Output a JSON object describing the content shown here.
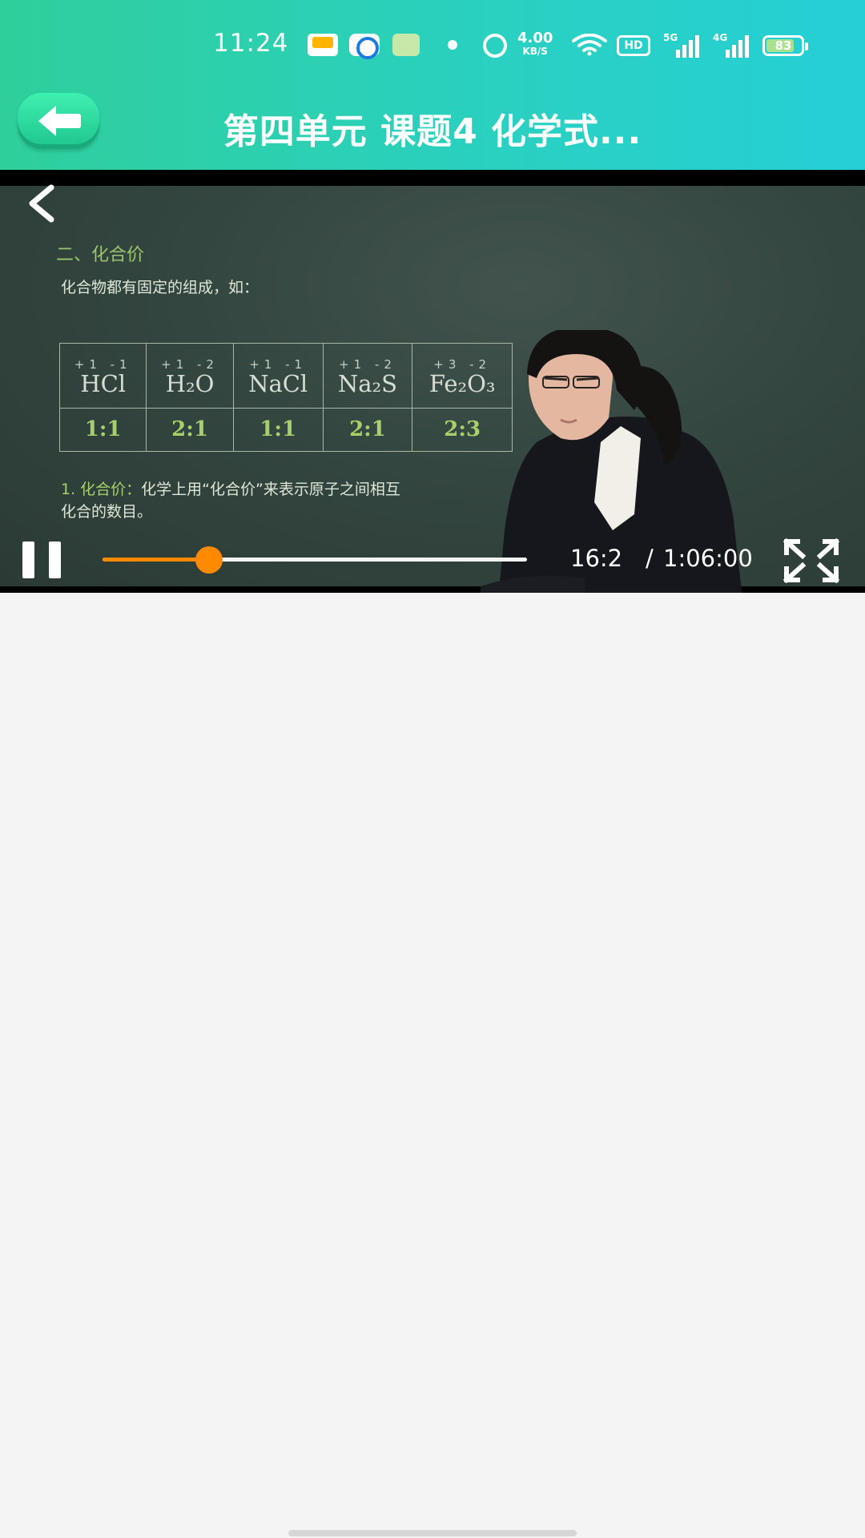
{
  "status_bar": {
    "time": "11:24",
    "net_speed_value": "4.00",
    "net_speed_unit": "KB/S",
    "hd_label": "HD",
    "signal_1_label": "5G",
    "signal_2_label": "4G",
    "battery_percent": "83",
    "battery_level": 0.83,
    "icons": [
      "app-icon-1",
      "app-icon-2",
      "app-icon-3",
      "dot-icon",
      "alarm-icon",
      "wifi-icon",
      "hd-icon",
      "signal-5g-icon",
      "signal-4g-icon",
      "battery-icon"
    ]
  },
  "title_bar": {
    "back_icon": "arrow-left-icon",
    "title": "第四单元 课题4 化学式..."
  },
  "video": {
    "board": {
      "heading": "二、化合价",
      "intro": "化合物都有固定的组成，如：",
      "table": [
        {
          "valence": "+1 -1",
          "formula": "HCl",
          "ratio": "1:1"
        },
        {
          "valence": "+1 -2",
          "formula": "H₂O",
          "ratio": "2:1"
        },
        {
          "valence": "+1 -1",
          "formula": "NaCl",
          "ratio": "1:1"
        },
        {
          "valence": "+1 -2",
          "formula": "Na₂S",
          "ratio": "2:1"
        },
        {
          "valence": "+3 -2",
          "formula": "Fe₂O₃",
          "ratio": "2:3"
        }
      ],
      "definition_keyword": "1. 化合价：",
      "definition_text": "化学上用“化合价”来表示原子之间相互",
      "definition_text_2": "化合的数目。"
    },
    "controls": {
      "current_time": "16:2",
      "separator": "/",
      "total_time": "1:06:00",
      "progress_fraction": 0.25,
      "progress_color": "#ff8a00",
      "pause_icon": "pause-icon",
      "fullscreen_icon": "fullscreen-icon",
      "back_icon": "chevron-left-icon"
    }
  },
  "colors": {
    "header_gradient_start": "#2fcf9b",
    "header_gradient_end": "#25cfd6",
    "page_background": "#f4f4f4"
  }
}
